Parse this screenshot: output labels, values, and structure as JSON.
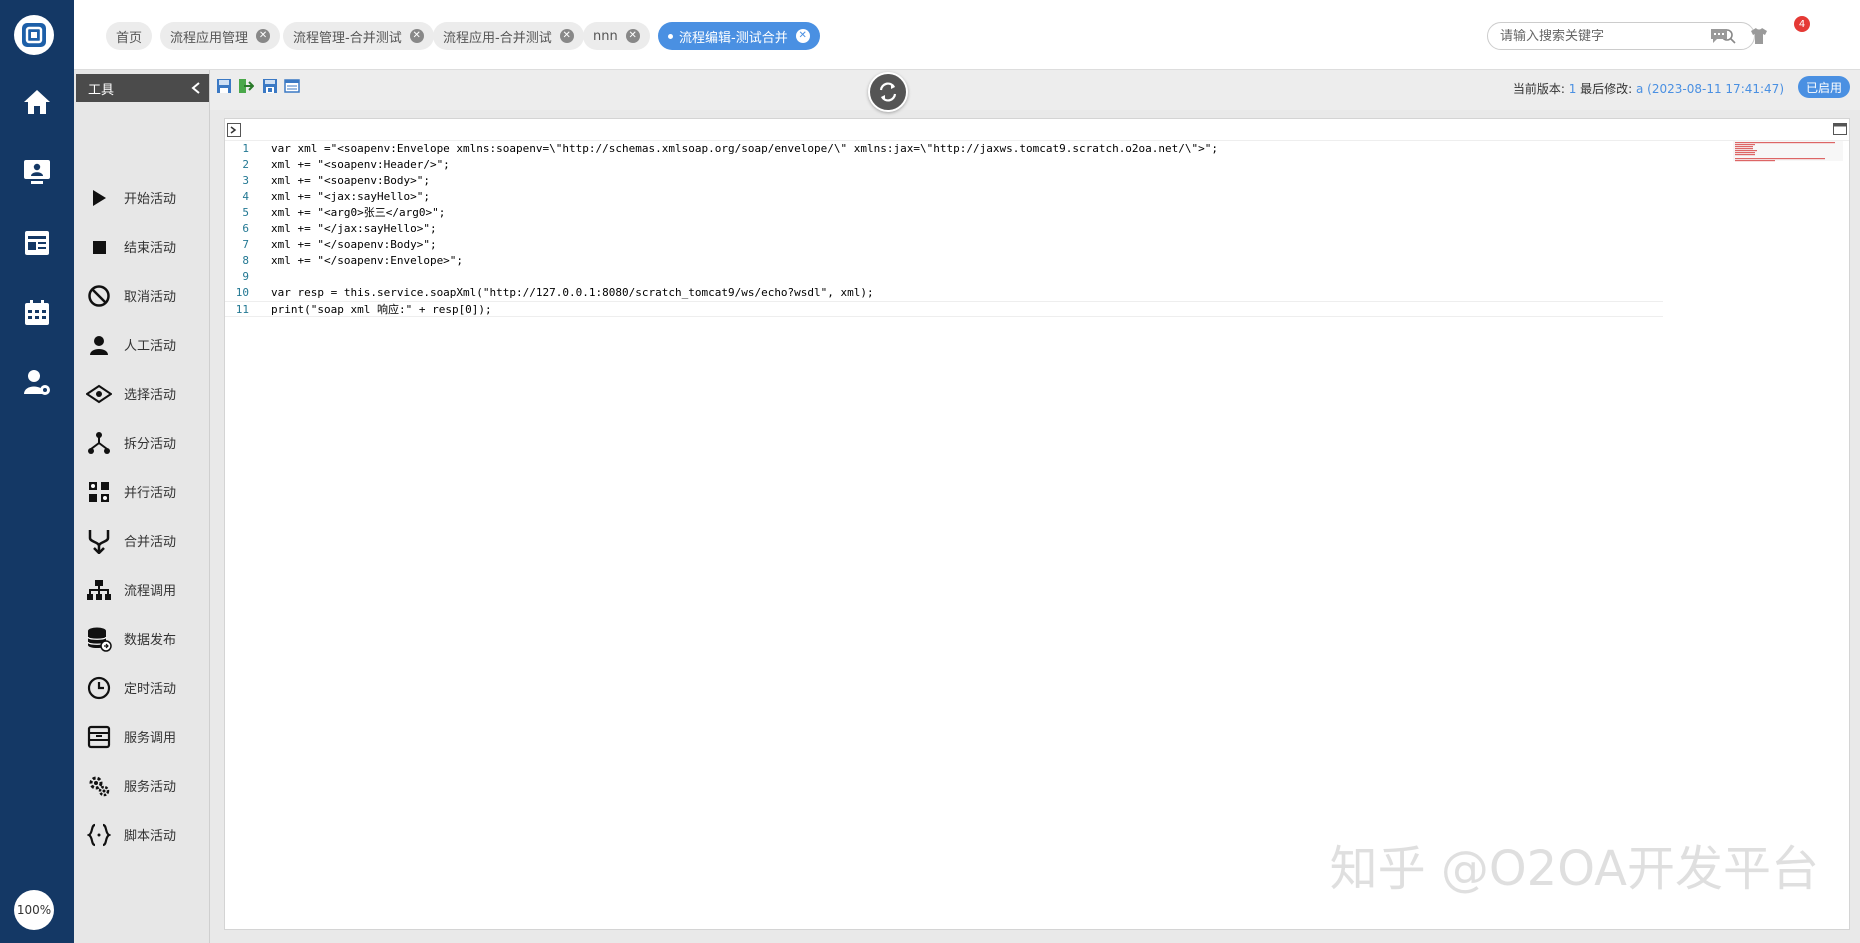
{
  "tabs": [
    {
      "label": "首页",
      "closable": false,
      "active": false
    },
    {
      "label": "流程应用管理",
      "closable": true,
      "active": false
    },
    {
      "label": "流程管理-合并测试",
      "closable": true,
      "active": false
    },
    {
      "label": "流程应用-合并测试",
      "closable": true,
      "active": false
    },
    {
      "label": "nnn",
      "closable": true,
      "active": false
    },
    {
      "label": "流程编辑-测试合并",
      "closable": true,
      "active": true
    }
  ],
  "search": {
    "placeholder": "请输入搜索关键字"
  },
  "notifications": {
    "count": "4"
  },
  "user": {
    "name": "a"
  },
  "zoom": "100%",
  "tools": {
    "title": "工具",
    "items": [
      {
        "label": "开始活动"
      },
      {
        "label": "结束活动"
      },
      {
        "label": "取消活动"
      },
      {
        "label": "人工活动"
      },
      {
        "label": "选择活动"
      },
      {
        "label": "拆分活动"
      },
      {
        "label": "并行活动"
      },
      {
        "label": "合并活动"
      },
      {
        "label": "流程调用"
      },
      {
        "label": "数据发布"
      },
      {
        "label": "定时活动"
      },
      {
        "label": "服务调用"
      },
      {
        "label": "服务活动"
      },
      {
        "label": "脚本活动"
      }
    ]
  },
  "version": {
    "label": "当前版本: ",
    "number": "1",
    "modified_label": " 最后修改: ",
    "modified_value": "a (2023-08-11 17:41:47)",
    "status": "已启用"
  },
  "code": {
    "lines": [
      "var xml =\"<soapenv:Envelope xmlns:soapenv=\\\"http://schemas.xmlsoap.org/soap/envelope/\\\" xmlns:jax=\\\"http://jaxws.tomcat9.scratch.o2oa.net/\\\">\";",
      "xml += \"<soapenv:Header/>\";",
      "xml += \"<soapenv:Body>\";",
      "xml += \"<jax:sayHello>\";",
      "xml += \"<arg0>张三</arg0>\";",
      "xml += \"</jax:sayHello>\";",
      "xml += \"</soapenv:Body>\";",
      "xml += \"</soapenv:Envelope>\";",
      "",
      "var resp = this.service.soapXml(\"http://127.0.0.1:8080/scratch_tomcat9/ws/echo?wsdl\", xml);",
      "print(\"soap xml 响应:\" + resp[0]);"
    ]
  },
  "watermark": "知乎 @O2OA开发平台",
  "colors": {
    "nav": "#143865",
    "accent": "#4a90e2",
    "badge": "#e53935"
  }
}
